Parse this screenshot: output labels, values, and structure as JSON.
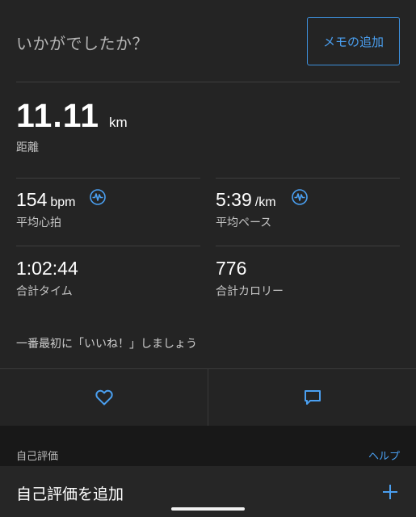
{
  "header": {
    "prompt": "いかがでしたか？",
    "memo_button": "メモの追加"
  },
  "distance": {
    "value": "11.11",
    "unit": "km",
    "label": "距離"
  },
  "stats": {
    "heart_rate": {
      "value": "154",
      "unit": "bpm",
      "label": "平均心拍"
    },
    "pace": {
      "value": "5:39",
      "unit": "/km",
      "label": "平均ペース"
    },
    "time": {
      "value": "1:02:44",
      "label": "合計タイム"
    },
    "calories": {
      "value": "776",
      "label": "合計カロリー"
    }
  },
  "social": {
    "like_prompt": "一番最初に「いいね！」しましょう"
  },
  "rating": {
    "header": "自己評価",
    "help": "ヘルプ",
    "add_label": "自己評価を追加"
  },
  "colors": {
    "background": "#242424",
    "accent": "#4a9ff0"
  },
  "icons": {
    "hr_chart": "pulse-chart-icon",
    "pace_chart": "pulse-chart-icon",
    "like": "heart-icon",
    "comment": "comment-icon",
    "add": "plus-icon"
  }
}
